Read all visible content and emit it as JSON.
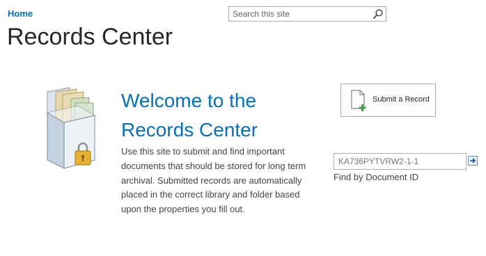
{
  "nav": {
    "home_label": "Home"
  },
  "page": {
    "title": "Records Center"
  },
  "search": {
    "placeholder": "Search this site",
    "icon": "magnifier-icon"
  },
  "welcome": {
    "heading": "Welcome to the Records Center",
    "description": "Use this site to submit and find important documents that should be stored for long term archival. Submitted records are automatically placed in the correct library and folder based upon the properties you fill out."
  },
  "submit": {
    "label": "Submit a Record",
    "icon": "document-add-icon"
  },
  "find": {
    "value": "KA736PYTVRW2-1-1",
    "label": "Find by Document ID",
    "go_icon": "go-arrow-icon"
  },
  "colors": {
    "accent": "#0072c6",
    "title": "#262626",
    "body_text": "#444444"
  }
}
